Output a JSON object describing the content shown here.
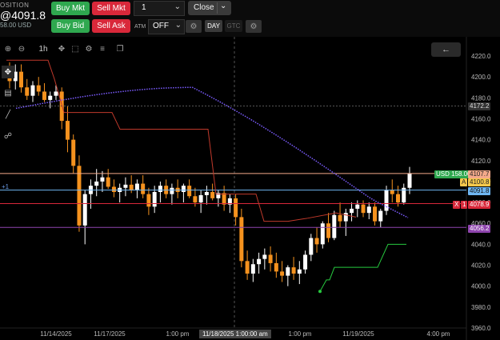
{
  "position": {
    "label": "OSITION",
    "price": "@4091.8",
    "pnl": "58.00 USD"
  },
  "order_buttons": {
    "buy_mkt": "Buy Mkt",
    "sell_mkt": "Sell Mkt",
    "buy_bid": "Buy Bid",
    "sell_ask": "Sell Ask"
  },
  "quantity": "1",
  "close_label": "Close",
  "atm": {
    "label": "ATM",
    "value": "OFF"
  },
  "tif": {
    "day": "DAY",
    "gtc": "GTC"
  },
  "toolbar": {
    "interval_label": "1h"
  },
  "left_label": "+1",
  "price_axis": {
    "ticks": [
      "4220.0",
      "4200.0",
      "4180.0",
      "4160.0",
      "4140.0",
      "4120.0",
      "4100.0",
      "4080.0",
      "4060.0",
      "4040.0",
      "4020.0",
      "4000.0",
      "3980.0",
      "3960.0"
    ],
    "tags": {
      "p4172": "4172.2",
      "p4107": "4107.7",
      "p4100": "4100.8",
      "p4091": "4091.8",
      "p4078": "4078.9",
      "p4056": "4056.2"
    },
    "usd_tag": "USD 158.00",
    "a_tag": "A",
    "x_tag": "X",
    "one_tag": "1"
  },
  "time_axis": {
    "labels": [
      "11/14/2025",
      "11/17/2025",
      "1:00 pm",
      "1:00 pm",
      "11/19/2025",
      "4:00 pm"
    ],
    "crosshair": "11/18/2025 1:00:00 am"
  },
  "colors": {
    "bull": "#ffffff",
    "bear": "#f5921e",
    "buy": "#2fa84f",
    "sell": "#d9283a",
    "trail": "#c0392b",
    "stop": "#27c93f",
    "curve": "#7b5cff"
  },
  "chart_data": {
    "type": "candlestick",
    "ylim": [
      3960,
      4225
    ],
    "candles": [
      [
        4208,
        4214,
        4189,
        4196
      ],
      [
        4196,
        4212,
        4188,
        4205
      ],
      [
        4205,
        4212,
        4185,
        4190
      ],
      [
        4190,
        4198,
        4178,
        4182
      ],
      [
        4182,
        4196,
        4176,
        4192
      ],
      [
        4192,
        4200,
        4182,
        4186
      ],
      [
        4186,
        4194,
        4176,
        4178
      ],
      [
        4178,
        4186,
        4170,
        4182
      ],
      [
        4182,
        4192,
        4178,
        4186
      ],
      [
        4186,
        4190,
        4150,
        4158
      ],
      [
        4158,
        4172,
        4128,
        4140
      ],
      [
        4140,
        4145,
        4108,
        4115
      ],
      [
        4115,
        4125,
        4052,
        4058
      ],
      [
        4058,
        4092,
        4040,
        4088
      ],
      [
        4088,
        4102,
        4074,
        4096
      ],
      [
        4096,
        4112,
        4086,
        4100
      ],
      [
        4100,
        4110,
        4090,
        4104
      ],
      [
        4104,
        4112,
        4093,
        4095
      ],
      [
        4095,
        4102,
        4085,
        4090
      ],
      [
        4090,
        4098,
        4080,
        4094
      ],
      [
        4094,
        4104,
        4086,
        4097
      ],
      [
        4097,
        4106,
        4089,
        4092
      ],
      [
        4092,
        4102,
        4084,
        4098
      ],
      [
        4098,
        4106,
        4084,
        4088
      ],
      [
        4088,
        4094,
        4068,
        4076
      ],
      [
        4076,
        4096,
        4070,
        4090
      ],
      [
        4090,
        4100,
        4080,
        4096
      ],
      [
        4096,
        4102,
        4084,
        4088
      ],
      [
        4088,
        4098,
        4078,
        4094
      ],
      [
        4094,
        4102,
        4084,
        4090
      ],
      [
        4090,
        4098,
        4080,
        4096
      ],
      [
        4096,
        4102,
        4084,
        4086
      ],
      [
        4086,
        4094,
        4076,
        4080
      ],
      [
        4080,
        4092,
        4070,
        4087
      ],
      [
        4087,
        4096,
        4078,
        4090
      ],
      [
        4090,
        4098,
        4082,
        4084
      ],
      [
        4084,
        4092,
        4076,
        4089
      ],
      [
        4089,
        4096,
        4072,
        4078
      ],
      [
        4078,
        4088,
        4070,
        4084
      ],
      [
        4084,
        4088,
        4058,
        4066
      ],
      [
        4066,
        4074,
        4018,
        4024
      ],
      [
        4024,
        4034,
        4006,
        4012
      ],
      [
        4012,
        4026,
        4004,
        4021
      ],
      [
        4021,
        4032,
        4012,
        4026
      ],
      [
        4026,
        4036,
        4016,
        4030
      ],
      [
        4030,
        4038,
        4014,
        4022
      ],
      [
        4022,
        4032,
        4008,
        4014
      ],
      [
        4014,
        4024,
        4004,
        4010
      ],
      [
        4010,
        4020,
        4000,
        4018
      ],
      [
        4018,
        4028,
        4006,
        4012
      ],
      [
        4012,
        4024,
        4002,
        4016
      ],
      [
        4016,
        4034,
        4012,
        4030
      ],
      [
        4030,
        4050,
        4024,
        4046
      ],
      [
        4046,
        4056,
        4032,
        4040
      ],
      [
        4040,
        4062,
        4036,
        4060
      ],
      [
        4060,
        4070,
        4042,
        4046
      ],
      [
        4046,
        4072,
        4044,
        4068
      ],
      [
        4068,
        4080,
        4056,
        4062
      ],
      [
        4062,
        4074,
        4048,
        4070
      ],
      [
        4070,
        4080,
        4062,
        4074
      ],
      [
        4074,
        4082,
        4066,
        4078
      ],
      [
        4078,
        4082,
        4066,
        4070
      ],
      [
        4070,
        4080,
        4064,
        4076
      ],
      [
        4076,
        4080,
        4058,
        4062
      ],
      [
        4062,
        4074,
        4056,
        4072
      ],
      [
        4072,
        4096,
        4068,
        4092
      ],
      [
        4092,
        4102,
        4080,
        4088
      ],
      [
        4088,
        4096,
        4076,
        4080
      ],
      [
        4080,
        4098,
        4078,
        4094
      ],
      [
        4094,
        4114,
        4088,
        4108
      ]
    ]
  }
}
